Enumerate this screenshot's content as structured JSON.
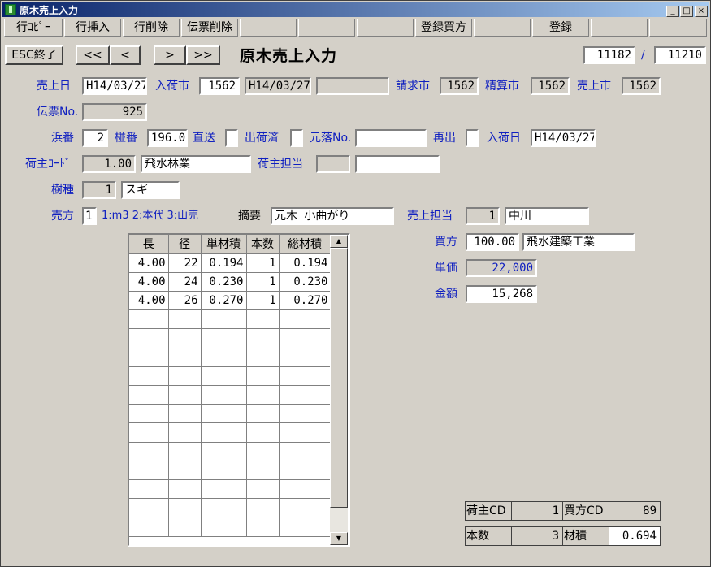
{
  "window": {
    "title": "原木売上入力",
    "min": "_",
    "max": "□",
    "close": "×"
  },
  "toolbar": [
    "行ｺﾋﾟｰ",
    "行挿入",
    "行削除",
    "伝票削除",
    "",
    "",
    "",
    "登録買方",
    "",
    "登録",
    "",
    ""
  ],
  "nav": {
    "esc": "ESC終了",
    "first": "<<",
    "prev": "<",
    "next": ">",
    "last": ">>"
  },
  "page_title": "原木売上入力",
  "record": {
    "current": "11182",
    "sep": "/",
    "total": "11210"
  },
  "form": {
    "sale_date_label": "売上日",
    "sale_date": "H14/03/27",
    "arrival_market_label": "入荷市",
    "arrival_market": "1562",
    "arrival_market_date": "H14/03/27",
    "arrival_market_extra": "",
    "billing_market_label": "請求市",
    "billing_market": "1562",
    "settle_market_label": "精算市",
    "settle_market": "1562",
    "sales_market_label": "売上市",
    "sales_market": "1562",
    "slip_no_label": "伝票No.",
    "slip_no": "925",
    "hama_label": "浜番",
    "hama": "2",
    "hae_label": "椪番",
    "hae": "196.0",
    "direct_label": "直送",
    "direct": "",
    "shipped_label": "出荷済",
    "shipped": "",
    "origin_no_label": "元落No.",
    "origin_no": "",
    "reout_label": "再出",
    "reout": "",
    "arrival_date_label": "入荷日",
    "arrival_date": "H14/03/27",
    "shipper_code_label": "荷主ｺｰﾄﾞ",
    "shipper_code": "1.00",
    "shipper_name": "飛水林業",
    "shipper_rep_label": "荷主担当",
    "shipper_rep_code": "",
    "shipper_rep_name": "",
    "species_label": "樹種",
    "species_code": "1",
    "species_name": "スギ",
    "sale_method_label": "売方",
    "sale_method": "1",
    "sale_method_hint": "1:m3 2:本代 3:山売",
    "summary_label": "摘要",
    "summary": "元木 小曲がり",
    "sales_rep_label": "売上担当",
    "sales_rep_code": "1",
    "sales_rep_name": "中川",
    "buyer_label": "買方",
    "buyer_code": "100.00",
    "buyer_name": "飛水建築工業",
    "unit_price_label": "単価",
    "unit_price": "22,000",
    "amount_label": "金額",
    "amount": "15,268"
  },
  "grid": {
    "headers": [
      "長",
      "径",
      "単材積",
      "本数",
      "総材積"
    ],
    "rows": [
      [
        "4.00",
        "22",
        "0.194",
        "1",
        "0.194"
      ],
      [
        "4.00",
        "24",
        "0.230",
        "1",
        "0.230"
      ],
      [
        "4.00",
        "26",
        "0.270",
        "1",
        "0.270"
      ]
    ],
    "scroll_up": "▲",
    "scroll_down": "▼"
  },
  "summary": {
    "shipper_cd_label": "荷主CD",
    "shipper_cd": "1",
    "buyer_cd_label": "買方CD",
    "buyer_cd": "89",
    "count_label": "本数",
    "count": "3",
    "volume_label": "材積",
    "volume": "0.694"
  }
}
